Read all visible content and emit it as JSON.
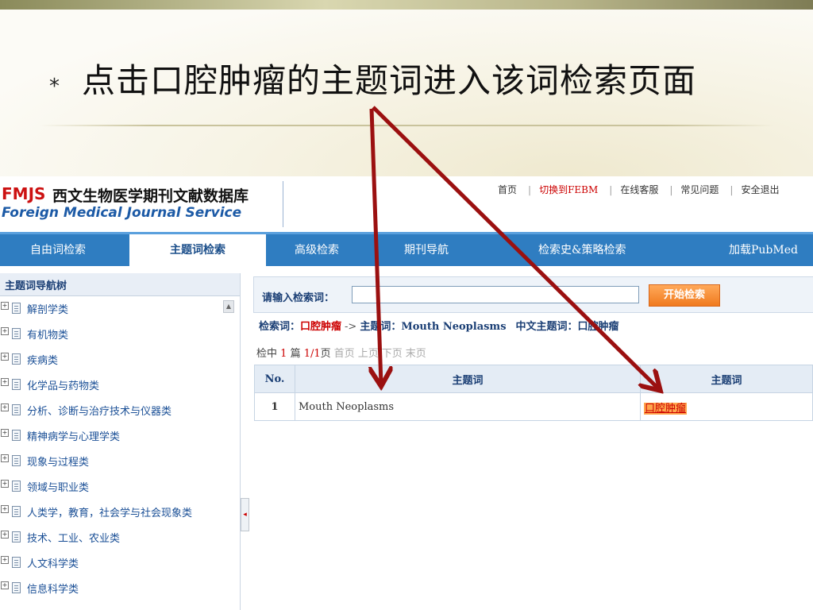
{
  "slide": {
    "bullet": "⁎",
    "title": "点击口腔肿瘤的主题词进入该词检索页面"
  },
  "header": {
    "logo_abbr": "FMJS",
    "logo_cn": "西文生物医学期刊文献数据库",
    "logo_en": "Foreign Medical Journal Service",
    "links": [
      "首页",
      "切换到FEBM",
      "在线客服",
      "常见问题",
      "安全退出"
    ]
  },
  "nav": {
    "tabs": [
      "自由词检索",
      "主题词检索",
      "高级检索",
      "期刊导航",
      "检索史&策略检索",
      "加载PubMed"
    ],
    "active": "主题词检索"
  },
  "sidebar": {
    "title": "主题词导航树",
    "items": [
      "解剖学类",
      "有机物类",
      "疾病类",
      "化学品与药物类",
      "分析、诊断与治疗技术与仪器类",
      "精神病学与心理学类",
      "现象与过程类",
      "领域与职业类",
      "人类学，教育，社会学与社会现象类",
      "技术、工业、农业类",
      "人文科学类",
      "信息科学类"
    ]
  },
  "search": {
    "label": "请输入检索词：",
    "value": "",
    "button": "开始检索"
  },
  "crumbs": {
    "term_label": "检索词：",
    "term_value": "口腔肿瘤",
    "arrow": "->",
    "subject_label": "主题词：",
    "subject_value": "Mouth Neoplasms",
    "cn_subject_label": "中文主题词：",
    "cn_subject_value": "口腔肿瘤"
  },
  "pager": {
    "prefix": "检中",
    "count": "1",
    "unit": "篇",
    "page": "1/1",
    "page_suffix": "页",
    "first": "首页",
    "prev": "上页",
    "next": "下页",
    "last": "末页"
  },
  "table": {
    "headers": [
      "No.",
      "主题词",
      "主题词"
    ],
    "rows": [
      {
        "no": "1",
        "en": "Mouth Neoplasms",
        "cn": "口腔肿瘤"
      }
    ]
  },
  "colors": {
    "nav_bar": "#2f7dc1",
    "annotation_arrow": "#9b1010",
    "highlight": "#ffa64d"
  }
}
